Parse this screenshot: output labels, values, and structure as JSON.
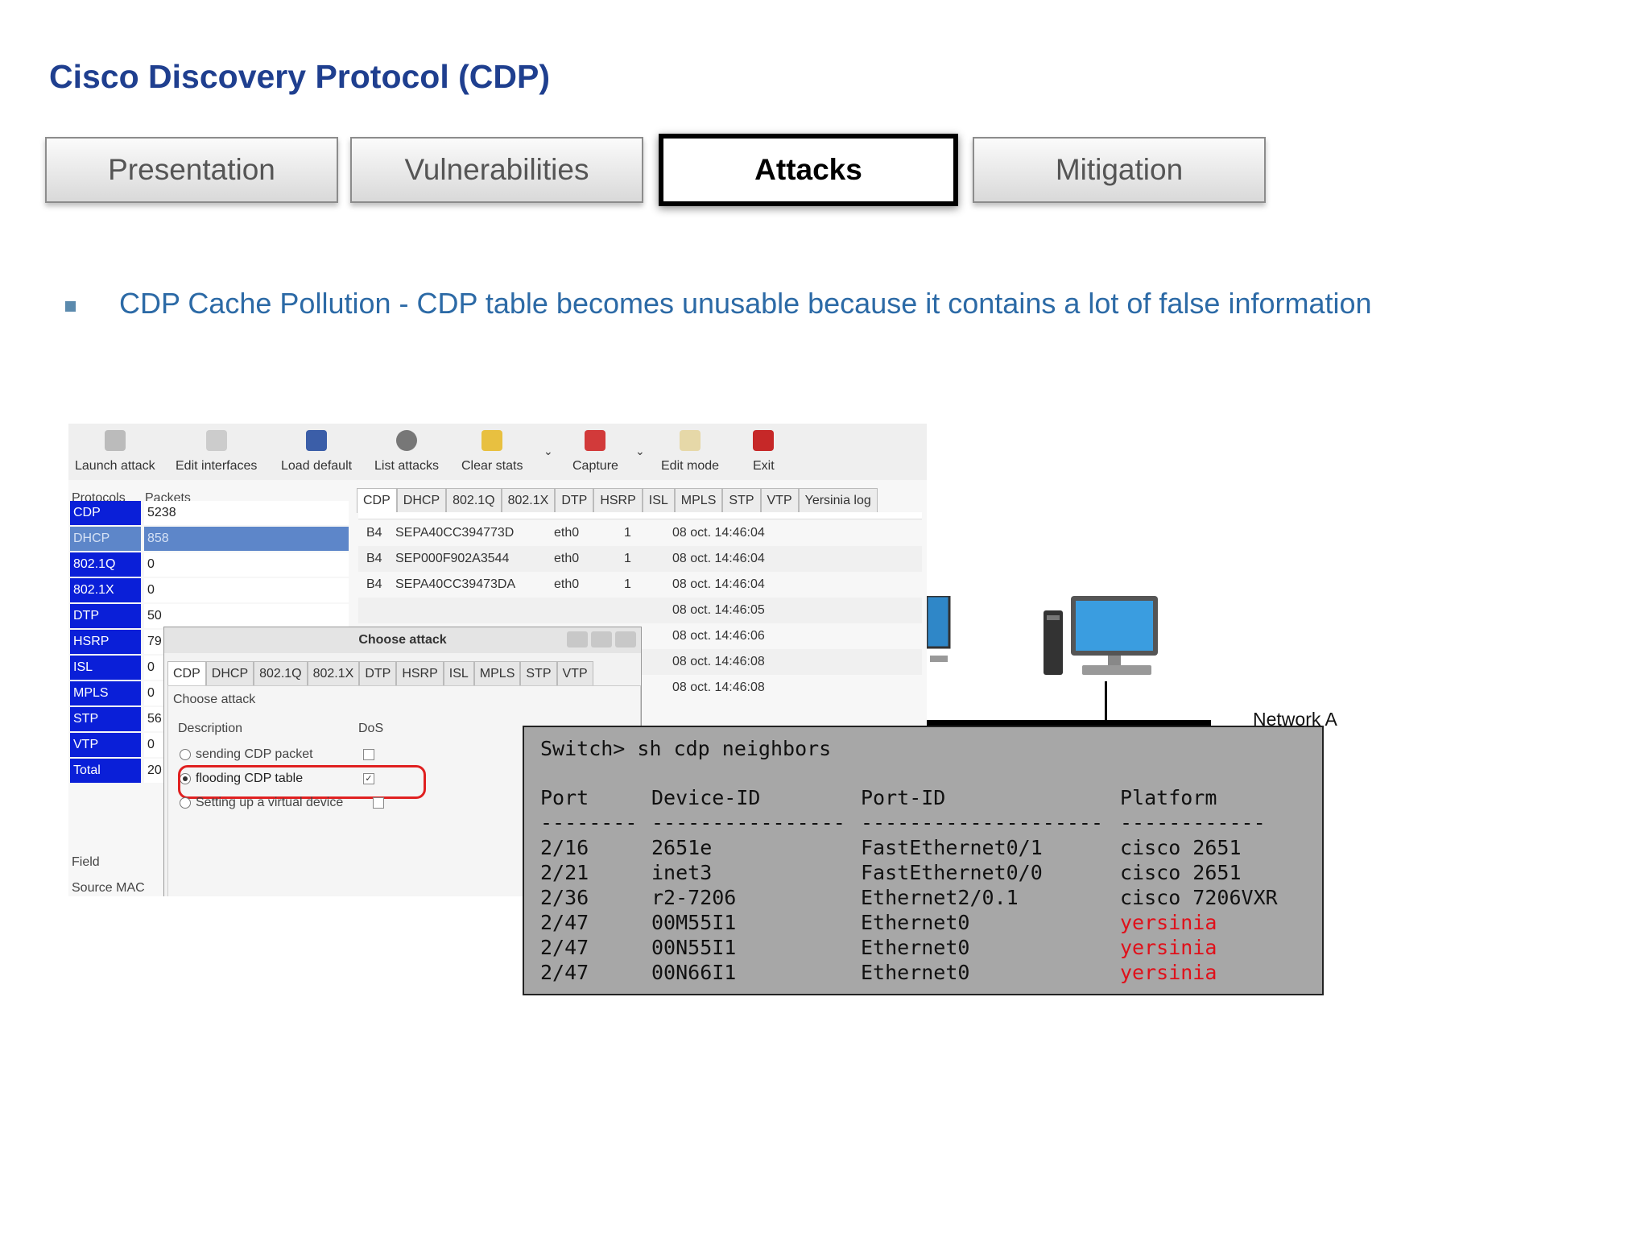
{
  "slide": {
    "title": "Cisco Discovery Protocol (CDP)",
    "tabs": [
      {
        "label": "Presentation",
        "active": false
      },
      {
        "label": "Vulnerabilities",
        "active": false
      },
      {
        "label": "Attacks",
        "active": true
      },
      {
        "label": "Mitigation",
        "active": false
      }
    ],
    "bullet": "CDP Cache Pollution - CDP table becomes unusable because it contains a lot of false information"
  },
  "yersinia": {
    "toolbar": [
      "Launch attack",
      "Edit interfaces",
      "Load default",
      "List attacks",
      "Clear stats",
      "Capture",
      "Edit mode",
      "Exit"
    ],
    "protocols_header": "Protocols",
    "packets_header": "Packets",
    "protocols": [
      {
        "name": "CDP",
        "packets": "5238"
      },
      {
        "name": "DHCP",
        "packets": "858"
      },
      {
        "name": "802.1Q",
        "packets": "0"
      },
      {
        "name": "802.1X",
        "packets": "0"
      },
      {
        "name": "DTP",
        "packets": "50"
      },
      {
        "name": "HSRP",
        "packets": "79"
      },
      {
        "name": "ISL",
        "packets": "0"
      },
      {
        "name": "MPLS",
        "packets": "0"
      },
      {
        "name": "STP",
        "packets": "56"
      },
      {
        "name": "VTP",
        "packets": "0"
      },
      {
        "name": "Total",
        "packets": "20"
      }
    ],
    "right_tabs": [
      "CDP",
      "DHCP",
      "802.1Q",
      "802.1X",
      "DTP",
      "HSRP",
      "ISL",
      "MPLS",
      "STP",
      "VTP",
      "Yersinia log"
    ],
    "cdp_rows": [
      {
        "ttl": "B4",
        "devid": "SEPA40CC394773D",
        "iface": "eth0",
        "count": "1",
        "seen": "08 oct. 14:46:04"
      },
      {
        "ttl": "B4",
        "devid": "SEP000F902A3544",
        "iface": "eth0",
        "count": "1",
        "seen": "08 oct. 14:46:04"
      },
      {
        "ttl": "B4",
        "devid": "SEPA40CC39473DA",
        "iface": "eth0",
        "count": "1",
        "seen": "08 oct. 14:46:04"
      },
      {
        "ttl": "",
        "devid": "",
        "iface": "",
        "count": "",
        "seen": "08 oct. 14:46:05"
      },
      {
        "ttl": "",
        "devid": "",
        "iface": "",
        "count": "",
        "seen": "08 oct. 14:46:06"
      },
      {
        "ttl": "",
        "devid": "",
        "iface": "",
        "count": "",
        "seen": "08 oct. 14:46:08"
      },
      {
        "ttl": "",
        "devid": "",
        "iface": "",
        "count": "",
        "seen": "08 oct. 14:46:08"
      }
    ],
    "field_label": "Field",
    "source_mac_label": "Source MAC",
    "dialog": {
      "title": "Choose attack",
      "tabs": [
        "CDP",
        "DHCP",
        "802.1Q",
        "802.1X",
        "DTP",
        "HSRP",
        "ISL",
        "MPLS",
        "STP",
        "VTP"
      ],
      "group_label": "Choose attack",
      "description_header": "Description",
      "dos_header": "DoS",
      "options": [
        {
          "label": "sending CDP packet",
          "selected": false,
          "dos": false
        },
        {
          "label": "flooding CDP table",
          "selected": true,
          "dos": true
        },
        {
          "label": "Setting up a virtual device",
          "selected": false,
          "dos": false
        }
      ]
    }
  },
  "network": {
    "label": "Network A"
  },
  "terminal": {
    "command": "Switch> sh cdp neighbors",
    "headers": [
      "Port",
      "Device-ID",
      "Port-ID",
      "Platform"
    ],
    "separator": [
      "--------",
      "----------------",
      "--------------------",
      "------------"
    ],
    "rows": [
      {
        "port": "2/16",
        "device": "2651e",
        "port_id": "FastEthernet0/1",
        "platform": "cisco 2651",
        "spoofed": false
      },
      {
        "port": "2/21",
        "device": "inet3",
        "port_id": "FastEthernet0/0",
        "platform": "cisco 2651",
        "spoofed": false
      },
      {
        "port": "2/36",
        "device": "r2-7206",
        "port_id": "Ethernet2/0.1",
        "platform": "cisco 7206VXR",
        "spoofed": false
      },
      {
        "port": "2/47",
        "device": "00M55I1",
        "port_id": "Ethernet0",
        "platform": "yersinia",
        "spoofed": true
      },
      {
        "port": "2/47",
        "device": "00N55I1",
        "port_id": "Ethernet0",
        "platform": "yersinia",
        "spoofed": true
      },
      {
        "port": "2/47",
        "device": "00N66I1",
        "port_id": "Ethernet0",
        "platform": "yersinia",
        "spoofed": true
      }
    ],
    "spoof_color": "#e0101a"
  }
}
